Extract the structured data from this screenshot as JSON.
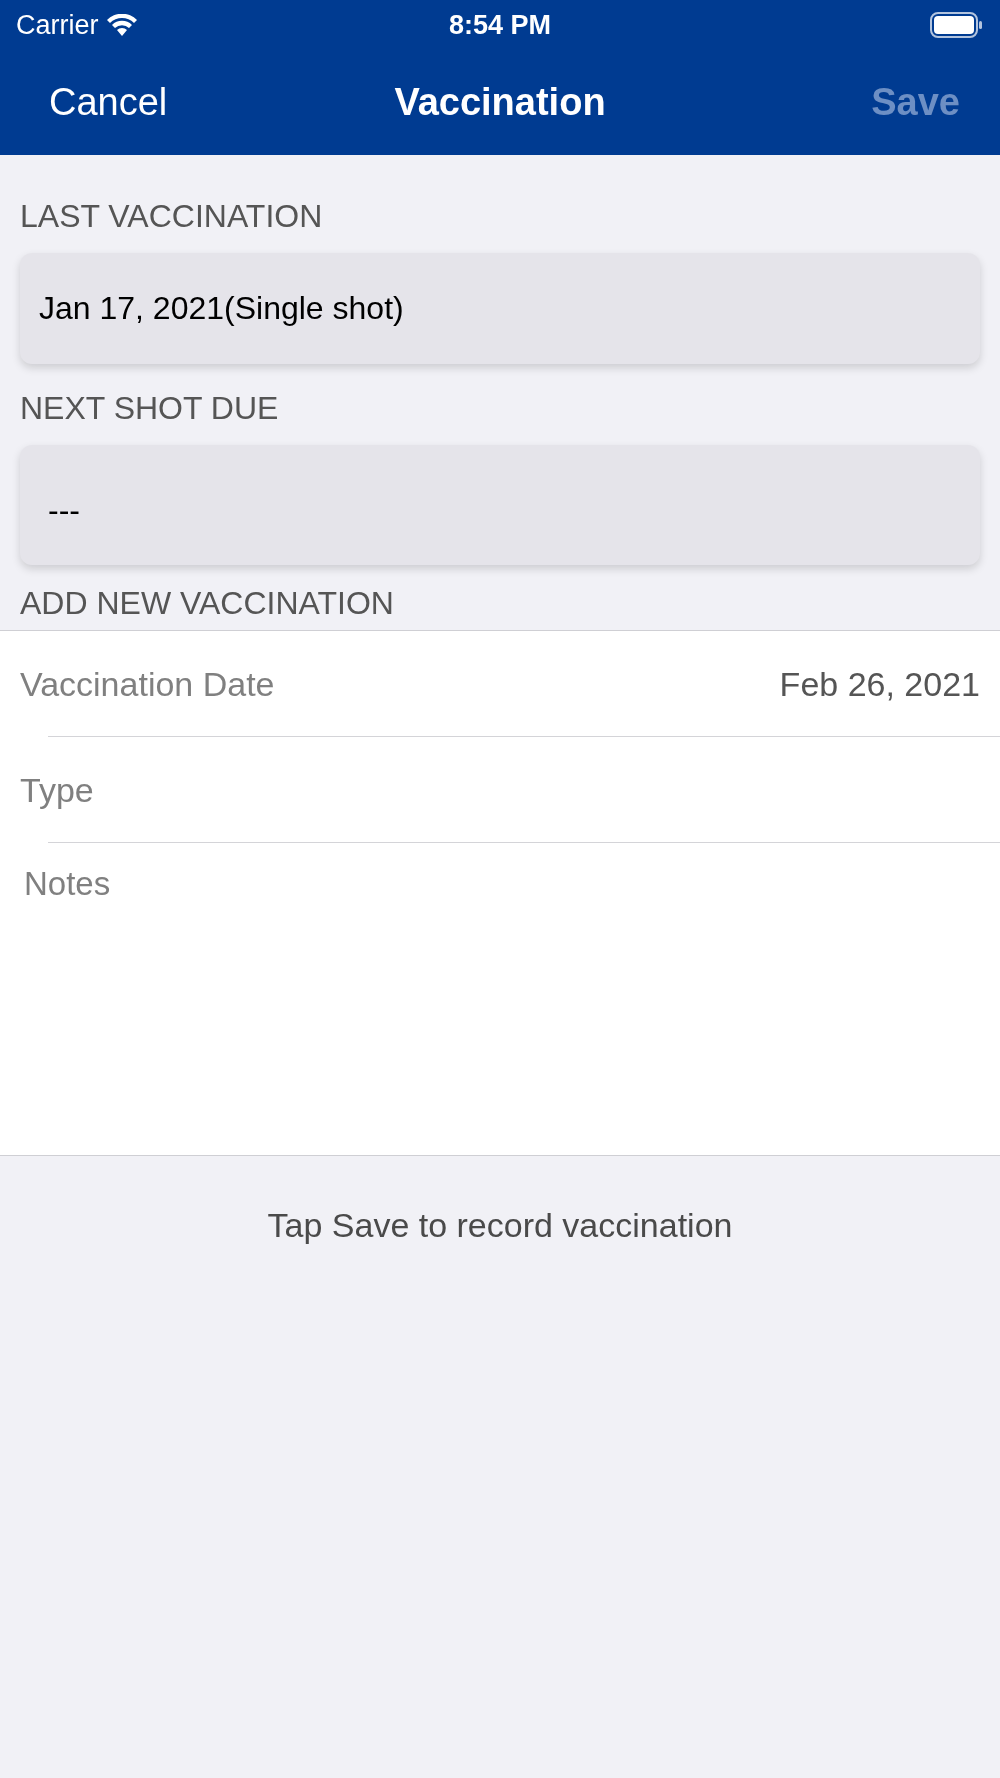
{
  "status_bar": {
    "carrier": "Carrier",
    "time": "8:54 PM"
  },
  "nav_bar": {
    "cancel": "Cancel",
    "title": "Vaccination",
    "save": {
      "label": "Save",
      "disabled": true
    }
  },
  "last_vaccination": {
    "header": "LAST VACCINATION",
    "value": "Jan 17, 2021(Single shot)"
  },
  "next_shot_due": {
    "header": "NEXT SHOT DUE",
    "value": "---"
  },
  "add_new_vaccination": {
    "header": "ADD NEW VACCINATION",
    "fields": [
      {
        "label": "Vaccination Date",
        "value": "Feb 26, 2021"
      },
      {
        "label": "Type"
      }
    ],
    "notes": {
      "placeholder": "Notes"
    }
  },
  "footer": "Tap Save to record vaccination"
}
